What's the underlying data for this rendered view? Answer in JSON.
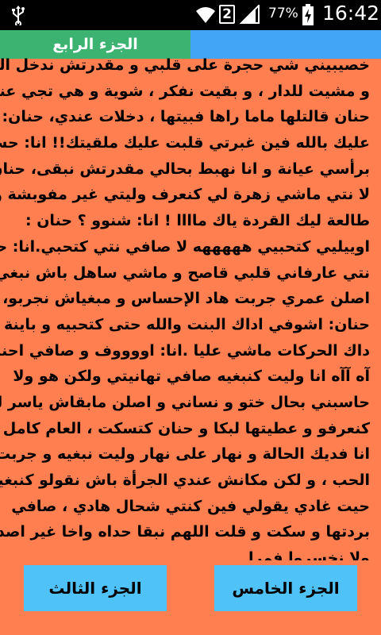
{
  "status_bar": {
    "sim_slot": "2",
    "battery_percent": "77%",
    "time": "16:42",
    "icons": [
      "usb-icon",
      "wifi-icon",
      "sim-icon",
      "signal-icon",
      "battery-charging-icon"
    ]
  },
  "tabs": {
    "active_label": "الجزء الرابع"
  },
  "story": {
    "lines": [
      "خصيبيني شي حجرة على قلبي و مقدرتش ندخل الحصة",
      "و مشيت للدار ، و بقيت نفكر ، شوية و هي تجي عندي",
      "حنان قالتلها ماما راها فبيتها ، دخلات عندي، حنان: دخلنا",
      "عليك بالله فين غبرتي قلبت عليك ملقيتك!! انا: حسيت",
      "برأسي عيانة و انا نهبط بحالي مقدرتش نبقى، حنان: لا",
      "لا نتي ماشي زهرة لي كنعرف وليتي غير مفوبشة و",
      "طالعة ليك القردة ياك ماااا ! انا: شنوو ؟ حنان :",
      "اوييليي كتحبيي هههههه لا صافي نتي كتحبي.انا: حمقة",
      "نتي عارفاني قلبي قاصح و ماشي ساهل باش نبغي و",
      "اصلن عمري جربت هاد الإحساس و مبغياش نجربو،",
      "حنان: اشوفي اداك البنت والله حتى كتحبيه و باينة عليك",
      "داك الحركات ماشي عليا .انا: اووووف و صافي احنان",
      "آه آآه انا وليت كنبغيه صافي تهانيتي ولكن هو ولا",
      "حاسبني بحال ختو و نساني و اصلن مابقاش ياسر لي",
      "كنعرفو  و عطيتها لبكا و حنان كتسكت ، العام كامل و",
      "انا فديك الحالة و نهار على نهار وليت نبغيه و جربت نار",
      "الحب ، و لكن مكانش عندي الجرأة باش نقولو كنبغيك ،",
      "حيت غادي يقولي فين كنتي شحال هادي ، صافي",
      "بردتها و سكت و قلت اللهم نبقا حداه واخا غير اصدقاء",
      "ولا نخسروا فمرا"
    ]
  },
  "buttons": {
    "prev_label": "الجزء الثالث",
    "next_label": "الجزء الخامس"
  },
  "colors": {
    "background": "#ff7f50",
    "tab_active": "#3cb371",
    "tab_inactive": "#42a5f5",
    "button": "#4fc3f7"
  }
}
